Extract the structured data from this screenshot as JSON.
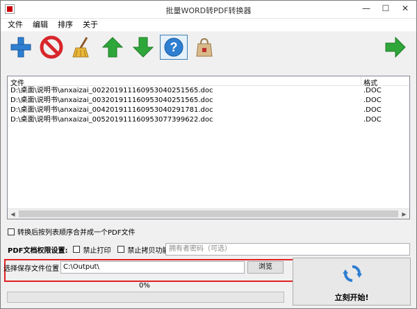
{
  "window": {
    "title": "批量WORD转PDF转换器",
    "min_icon": "minimize-icon",
    "max_icon": "maximize-icon",
    "close_icon": "close-icon"
  },
  "menu": [
    "文件",
    "编辑",
    "排序",
    "关于"
  ],
  "toolbar": {
    "buttons": [
      {
        "name": "add-file-button",
        "icon": "plus-icon"
      },
      {
        "name": "remove-file-button",
        "icon": "prohibited-icon"
      },
      {
        "name": "clear-list-button",
        "icon": "broom-icon"
      },
      {
        "name": "move-up-button",
        "icon": "arrow-up-icon"
      },
      {
        "name": "move-down-button",
        "icon": "arrow-down-icon"
      },
      {
        "name": "help-button",
        "icon": "question-icon"
      },
      {
        "name": "buy-button",
        "icon": "shopping-bag-icon"
      },
      {
        "name": "next-button",
        "icon": "arrow-right-icon"
      }
    ],
    "colors": {
      "blue": "#2f7fd1",
      "red": "#d8262b",
      "green": "#2fa63a"
    }
  },
  "filelist": {
    "col_file": "文件",
    "col_format": "格式",
    "rows": [
      {
        "name": "D:\\桌面\\说明书\\anxaizai_00220191116095304025156​5.doc",
        "format": ".DOC"
      },
      {
        "name": "D:\\桌面\\说明书\\anxaizai_003201911160953040251565.doc",
        "format": ".DOC"
      },
      {
        "name": "D:\\桌面\\说明书\\anxaizai_004201911160953040291781.doc",
        "format": ".DOC"
      },
      {
        "name": "D:\\桌面\\说明书\\anxaizai_005201911160953077399622.doc",
        "format": ".DOC"
      }
    ]
  },
  "merge_option": "转换后按列表顺序合并成一个PDF文件",
  "permissions": {
    "label": "PDF文档权限设置:",
    "no_print": "禁止打印",
    "no_copy": "禁止拷贝功能",
    "owner_pwd_placeholder": "拥有者密码（可选）"
  },
  "output": {
    "label": "选择保存文件位置",
    "path": "C:\\Output\\",
    "browse": "浏览"
  },
  "progress": {
    "percent_text": "0%",
    "value": 0
  },
  "start": {
    "label": "立刻开始!"
  }
}
